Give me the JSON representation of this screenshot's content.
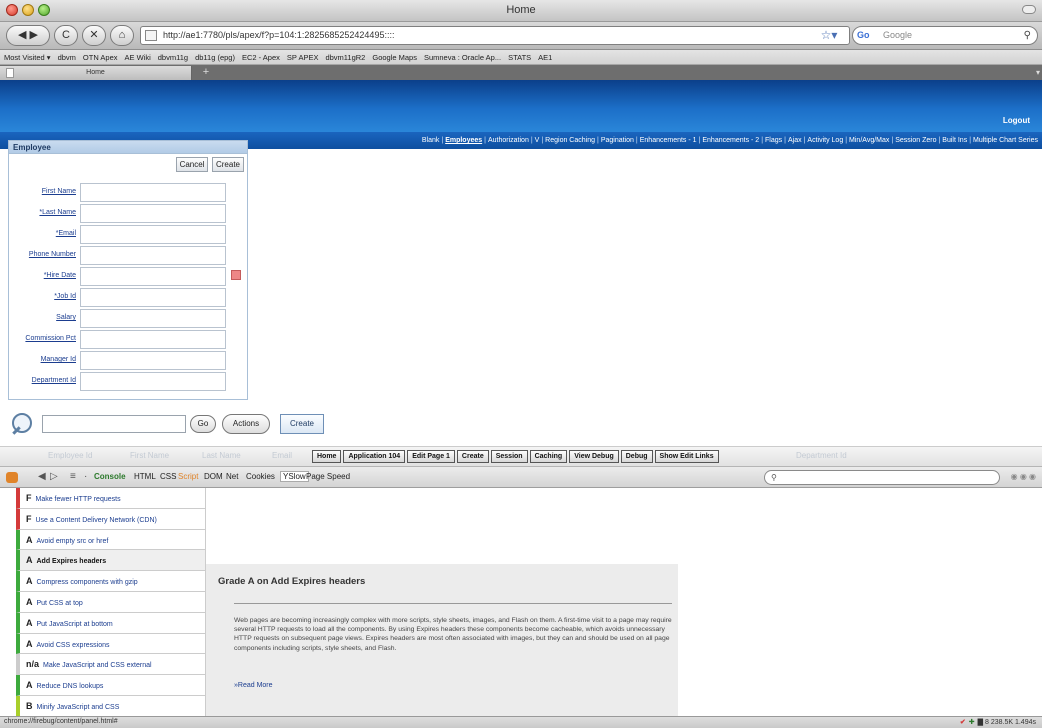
{
  "window": {
    "title": "Home"
  },
  "browser": {
    "url": "http://ae1:7780/pls/apex/f?p=104:1:2825685252424495::::",
    "search_placeholder": "Google",
    "google_logo": "Go",
    "buttons": {
      "back": "◀ ▶",
      "reload": "C",
      "stop": "✕",
      "home": "⌂",
      "star": "☆▾",
      "search": "⚲"
    },
    "bookmarks": [
      "Most Visited ▾",
      "dbvm",
      "OTN Apex",
      "AE Wiki",
      "dbvm11g",
      "db11g (epg)",
      "EC2 - Apex",
      "SP APEX",
      "dbvm11gR2",
      "Google Maps",
      "Sumneva : Oracle Ap...",
      "STATS",
      "AE1"
    ],
    "tab": {
      "label": "Home",
      "new_tab": "+",
      "scroll": "▾"
    }
  },
  "app": {
    "logout": "Logout",
    "nav": [
      "Blank",
      "Employees",
      "Authorization",
      "V",
      "Region Caching",
      "Pagination",
      "Enhancements - 1",
      "Enhancements - 2",
      "Flags",
      "Ajax",
      "Activity Log",
      "Min/Avg/Max",
      "Session Zero",
      "Built Ins",
      "Multiple Chart Series"
    ],
    "active_nav": "Employees"
  },
  "employee_form": {
    "title": "Employee",
    "cancel_label": "Cancel",
    "create_label": "Create",
    "fields": [
      {
        "label": "First Name",
        "value": ""
      },
      {
        "label": "*Last Name",
        "value": ""
      },
      {
        "label": "*Email",
        "value": ""
      },
      {
        "label": "Phone Number",
        "value": ""
      },
      {
        "label": "*Hire Date",
        "value": ""
      },
      {
        "label": "*Job Id",
        "value": ""
      },
      {
        "label": "Salary",
        "value": ""
      },
      {
        "label": "Commission Pct",
        "value": ""
      },
      {
        "label": "Manager Id",
        "value": ""
      },
      {
        "label": "Department Id",
        "value": ""
      }
    ]
  },
  "report_search": {
    "go_label": "Go",
    "actions_label": "Actions",
    "create_label": "Create"
  },
  "dev_toolbar": {
    "ghost_columns": [
      "Employee Id",
      "First Name",
      "Last Name",
      "Email",
      "Department Id"
    ],
    "buttons": [
      "Home",
      "Application 104",
      "Edit Page 1",
      "Create",
      "Session",
      "Caching",
      "View Debug",
      "Debug",
      "Show Edit Links"
    ]
  },
  "firebug": {
    "tabs": [
      "Console",
      "HTML",
      "CSS",
      "Script",
      "DOM",
      "Net",
      "Cookies",
      "YSlow",
      "Page Speed"
    ],
    "active_tab": "YSlow",
    "controls": [
      "◀",
      "▷",
      "≡",
      "·"
    ],
    "search_placeholder": "⚲",
    "window_buttons": "◉ ◉ ◉"
  },
  "yslow": {
    "rules": [
      {
        "grade": "F",
        "label": "Make fewer HTTP requests",
        "kind": "f"
      },
      {
        "grade": "F",
        "label": "Use a Content Delivery Network (CDN)",
        "kind": "f"
      },
      {
        "grade": "A",
        "label": "Avoid empty src or href",
        "kind": "a"
      },
      {
        "grade": "A",
        "label": "Add Expires headers",
        "kind": "sel"
      },
      {
        "grade": "A",
        "label": "Compress components with gzip",
        "kind": "a"
      },
      {
        "grade": "A",
        "label": "Put CSS at top",
        "kind": "a"
      },
      {
        "grade": "A",
        "label": "Put JavaScript at bottom",
        "kind": "a"
      },
      {
        "grade": "A",
        "label": "Avoid CSS expressions",
        "kind": "a"
      },
      {
        "grade": "n/a",
        "label": "Make JavaScript and CSS external",
        "kind": "na"
      },
      {
        "grade": "A",
        "label": "Reduce DNS lookups",
        "kind": "a"
      },
      {
        "grade": "B",
        "label": "Minify JavaScript and CSS",
        "kind": "b"
      }
    ],
    "detail": {
      "title": "Grade A on Add Expires headers",
      "body": "Web pages are becoming increasingly complex with more scripts, style sheets, images, and Flash on them. A first-time visit to a page may require several HTTP requests to load all the components. By using Expires headers these components become cacheable, which avoids unnecessary HTTP requests on subsequent page views. Expires headers are most often associated with images, but they can and should be used on all page components including scripts, style sheets, and Flash.",
      "more": "»Read More"
    }
  },
  "status": {
    "text": "chrome://firebug/content/panel.html#",
    "check": "✔",
    "flag": "✚",
    "right": "▇ 8   238.5K   1.494s"
  }
}
